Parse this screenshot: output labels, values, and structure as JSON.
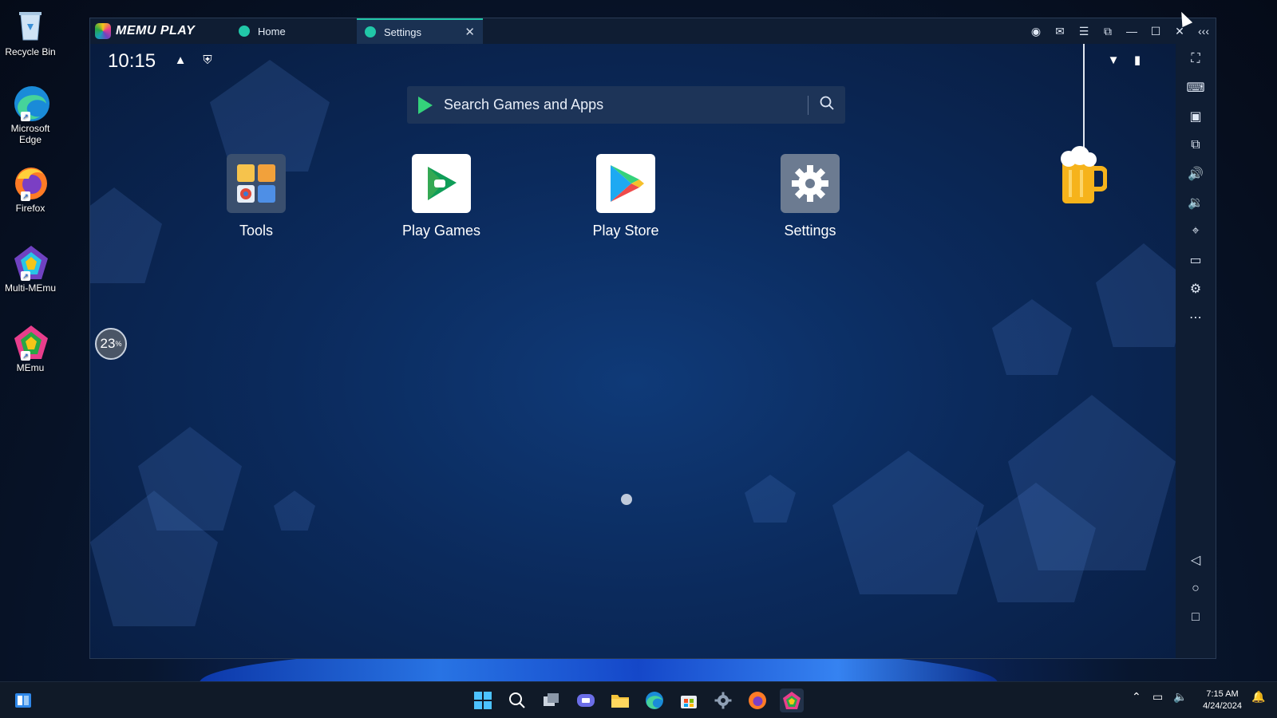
{
  "desktop": {
    "icons": [
      {
        "label": "Recycle Bin",
        "icon": "recycle-bin-icon"
      },
      {
        "label": "Microsoft Edge",
        "icon": "edge-icon"
      },
      {
        "label": "Firefox",
        "icon": "firefox-icon"
      },
      {
        "label": "Multi-MEmu",
        "icon": "multi-memu-icon"
      },
      {
        "label": "MEmu",
        "icon": "memu-icon"
      }
    ]
  },
  "emulator": {
    "brand": "MEMU PLAY",
    "tabs": [
      {
        "label": "Home",
        "icon": "home-tab-icon",
        "active": false
      },
      {
        "label": "Settings",
        "icon": "settings-tab-icon",
        "active": true
      }
    ],
    "android": {
      "time": "10:15",
      "search_placeholder": "Search Games and Apps",
      "apps": [
        {
          "label": "Tools",
          "icon": "tools-folder-icon"
        },
        {
          "label": "Play Games",
          "icon": "play-games-icon"
        },
        {
          "label": "Play Store",
          "icon": "play-store-icon"
        },
        {
          "label": "Settings",
          "icon": "settings-gear-icon"
        }
      ],
      "performance_percent": "23",
      "percent_sign": "%"
    }
  },
  "taskbar": {
    "time": "7:15 AM",
    "date": "4/24/2024"
  },
  "colors": {
    "accent": "#21c7a8",
    "play_green": "#34d27b"
  }
}
